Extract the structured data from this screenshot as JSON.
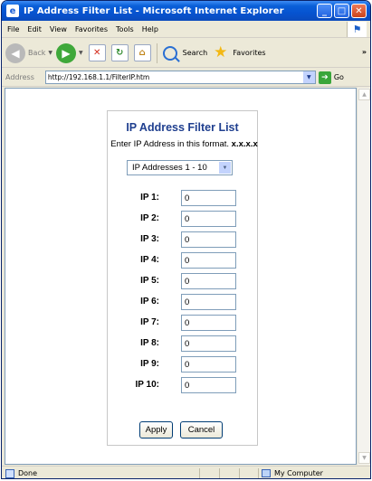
{
  "window": {
    "title": "IP Address Filter List - Microsoft Internet Explorer",
    "icon_glyph": "e",
    "buttons": {
      "minimize": "_",
      "maximize": "□",
      "close": "✕"
    }
  },
  "menu": [
    "File",
    "Edit",
    "View",
    "Favorites",
    "Tools",
    "Help"
  ],
  "toolbar": {
    "back_label": "Back",
    "search_label": "Search",
    "favorites_label": "Favorites",
    "overflow": "»"
  },
  "address": {
    "label": "Address",
    "url": "http://192.168.1.1/FilterIP.htm",
    "go_label": "Go"
  },
  "page": {
    "title": "IP Address Filter List",
    "instruction_prefix": "Enter IP Address in this format.",
    "instruction_format": "x.x.x.x",
    "select_value": "IP Addresses 1 - 10",
    "fields": [
      {
        "label": "IP 1:",
        "value": "0"
      },
      {
        "label": "IP 2:",
        "value": "0"
      },
      {
        "label": "IP 3:",
        "value": "0"
      },
      {
        "label": "IP 4:",
        "value": "0"
      },
      {
        "label": "IP 5:",
        "value": "0"
      },
      {
        "label": "IP 6:",
        "value": "0"
      },
      {
        "label": "IP 7:",
        "value": "0"
      },
      {
        "label": "IP 8:",
        "value": "0"
      },
      {
        "label": "IP 9:",
        "value": "0"
      },
      {
        "label": "IP 10:",
        "value": "0"
      }
    ],
    "apply_label": "Apply",
    "cancel_label": "Cancel"
  },
  "status": {
    "text": "Done",
    "zone": "My Computer"
  },
  "colors": {
    "title_bar": "#0653d0",
    "page_title": "#1f3f8f",
    "chrome": "#ece9d8"
  }
}
